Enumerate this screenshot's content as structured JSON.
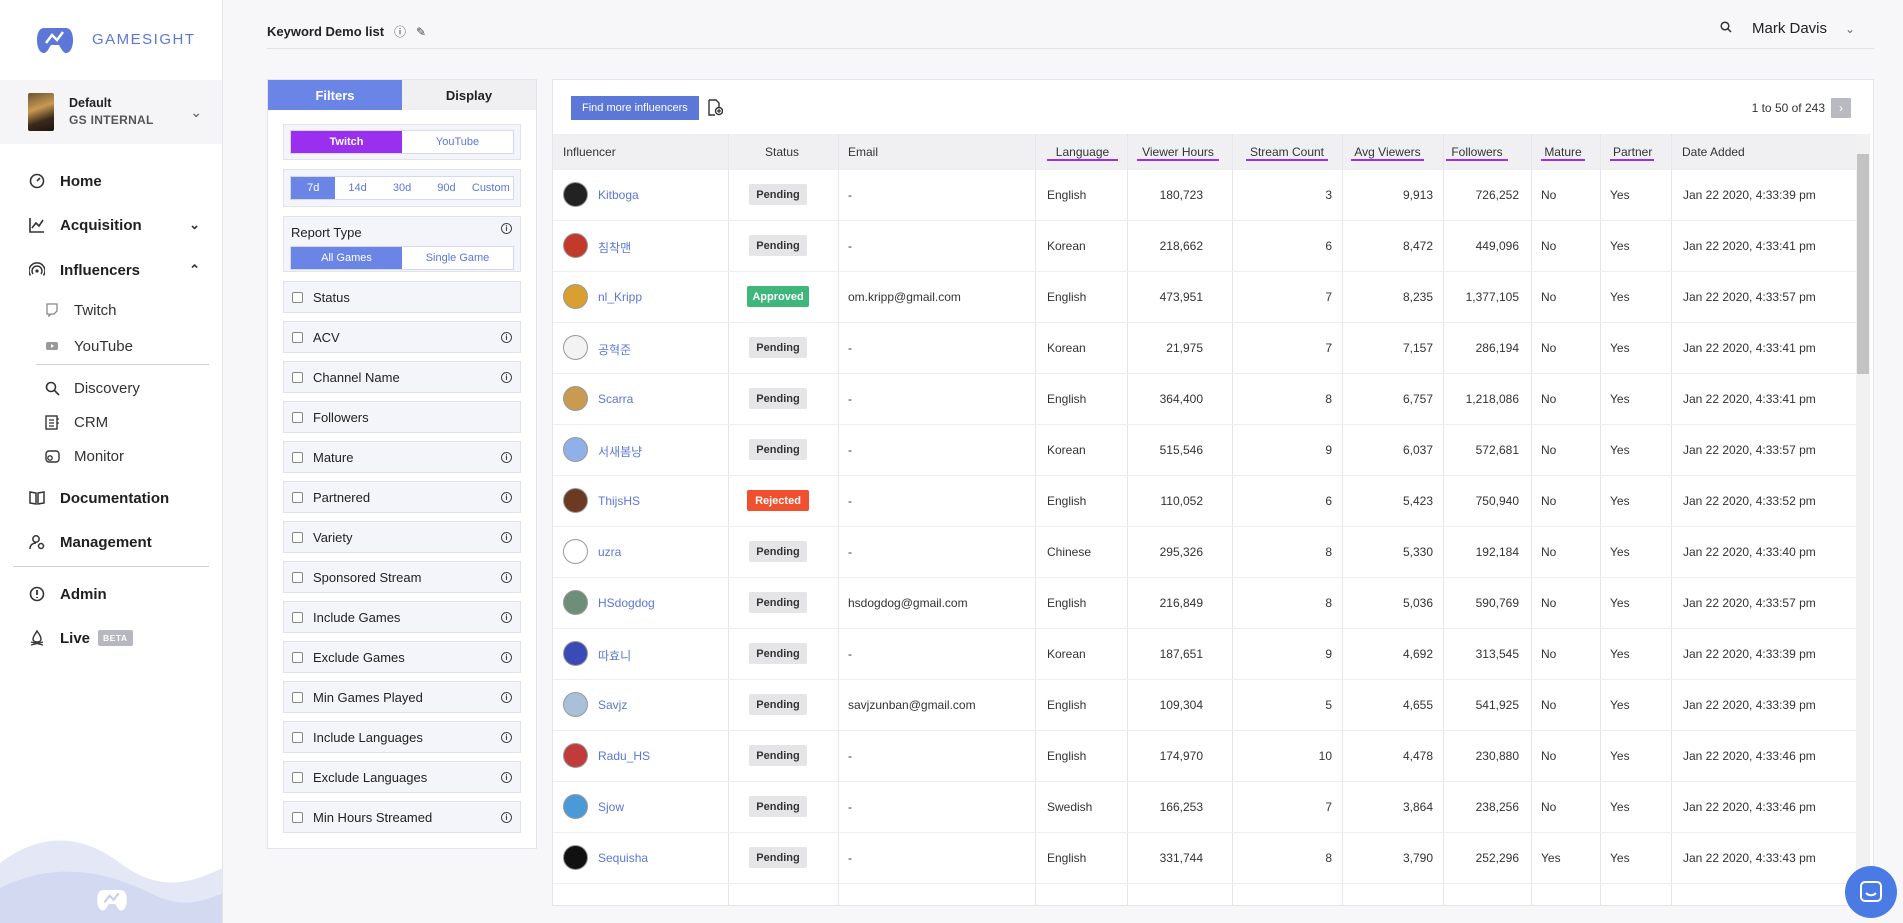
{
  "brand": {
    "name": "GAMESIGHT"
  },
  "org": {
    "name": "Default",
    "team": "GS INTERNAL"
  },
  "nav": {
    "home": "Home",
    "acquisition": "Acquisition",
    "influencers": "Influencers",
    "twitch": "Twitch",
    "youtube": "YouTube",
    "discovery": "Discovery",
    "crm": "CRM",
    "monitor": "Monitor",
    "documentation": "Documentation",
    "management": "Management",
    "admin": "Admin",
    "live": "Live",
    "live_badge": "BETA"
  },
  "header": {
    "title": "Keyword Demo list",
    "user": "Mark Davis"
  },
  "filters": {
    "tab_filters": "Filters",
    "tab_display": "Display",
    "platforms": [
      "Twitch",
      "YouTube"
    ],
    "ranges": [
      "7d",
      "14d",
      "30d",
      "90d",
      "Custom"
    ],
    "report_type_label": "Report Type",
    "report_types": [
      "All Games",
      "Single Game"
    ],
    "items": [
      "Status",
      "ACV",
      "Channel Name",
      "Followers",
      "Mature",
      "Partnered",
      "Variety",
      "Sponsored Stream",
      "Include Games",
      "Exclude Games",
      "Min Games Played",
      "Include Languages",
      "Exclude Languages",
      "Min Hours Streamed"
    ]
  },
  "table": {
    "find_more": "Find more influencers",
    "pagination": "1 to 50 of 243",
    "columns": [
      "Influencer",
      "Status",
      "Email",
      "Language",
      "Viewer Hours",
      "Stream Count",
      "Avg Viewers",
      "Followers",
      "Mature",
      "Partner",
      "Date Added"
    ],
    "rows": [
      {
        "name": "Kitboga",
        "status": "Pending",
        "email": "-",
        "language": "English",
        "viewer_hours": "180,723",
        "stream_count": "3",
        "avg_viewers": "9,913",
        "followers": "726,252",
        "mature": "No",
        "partner": "Yes",
        "date_added": "Jan 22 2020, 4:33:39 pm"
      },
      {
        "name": "침착맨",
        "status": "Pending",
        "email": "-",
        "language": "Korean",
        "viewer_hours": "218,662",
        "stream_count": "6",
        "avg_viewers": "8,472",
        "followers": "449,096",
        "mature": "No",
        "partner": "Yes",
        "date_added": "Jan 22 2020, 4:33:41 pm"
      },
      {
        "name": "nl_Kripp",
        "status": "Approved",
        "email": "om.kripp@gmail.com",
        "language": "English",
        "viewer_hours": "473,951",
        "stream_count": "7",
        "avg_viewers": "8,235",
        "followers": "1,377,105",
        "mature": "No",
        "partner": "Yes",
        "date_added": "Jan 22 2020, 4:33:57 pm"
      },
      {
        "name": "공혁준",
        "status": "Pending",
        "email": "-",
        "language": "Korean",
        "viewer_hours": "21,975",
        "stream_count": "7",
        "avg_viewers": "7,157",
        "followers": "286,194",
        "mature": "No",
        "partner": "Yes",
        "date_added": "Jan 22 2020, 4:33:41 pm"
      },
      {
        "name": "Scarra",
        "status": "Pending",
        "email": "-",
        "language": "English",
        "viewer_hours": "364,400",
        "stream_count": "8",
        "avg_viewers": "6,757",
        "followers": "1,218,086",
        "mature": "No",
        "partner": "Yes",
        "date_added": "Jan 22 2020, 4:33:41 pm"
      },
      {
        "name": "서새봄냥",
        "status": "Pending",
        "email": "-",
        "language": "Korean",
        "viewer_hours": "515,546",
        "stream_count": "9",
        "avg_viewers": "6,037",
        "followers": "572,681",
        "mature": "No",
        "partner": "Yes",
        "date_added": "Jan 22 2020, 4:33:57 pm"
      },
      {
        "name": "ThijsHS",
        "status": "Rejected",
        "email": "-",
        "language": "English",
        "viewer_hours": "110,052",
        "stream_count": "6",
        "avg_viewers": "5,423",
        "followers": "750,940",
        "mature": "No",
        "partner": "Yes",
        "date_added": "Jan 22 2020, 4:33:52 pm"
      },
      {
        "name": "uzra",
        "status": "Pending",
        "email": "-",
        "language": "Chinese",
        "viewer_hours": "295,326",
        "stream_count": "8",
        "avg_viewers": "5,330",
        "followers": "192,184",
        "mature": "No",
        "partner": "Yes",
        "date_added": "Jan 22 2020, 4:33:40 pm"
      },
      {
        "name": "HSdogdog",
        "status": "Pending",
        "email": "hsdogdog@gmail.com",
        "language": "English",
        "viewer_hours": "216,849",
        "stream_count": "8",
        "avg_viewers": "5,036",
        "followers": "590,769",
        "mature": "No",
        "partner": "Yes",
        "date_added": "Jan 22 2020, 4:33:57 pm"
      },
      {
        "name": "따효니",
        "status": "Pending",
        "email": "-",
        "language": "Korean",
        "viewer_hours": "187,651",
        "stream_count": "9",
        "avg_viewers": "4,692",
        "followers": "313,545",
        "mature": "No",
        "partner": "Yes",
        "date_added": "Jan 22 2020, 4:33:39 pm"
      },
      {
        "name": "Savjz",
        "status": "Pending",
        "email": "savjzunban@gmail.com",
        "language": "English",
        "viewer_hours": "109,304",
        "stream_count": "5",
        "avg_viewers": "4,655",
        "followers": "541,925",
        "mature": "No",
        "partner": "Yes",
        "date_added": "Jan 22 2020, 4:33:39 pm"
      },
      {
        "name": "Radu_HS",
        "status": "Pending",
        "email": "-",
        "language": "English",
        "viewer_hours": "174,970",
        "stream_count": "10",
        "avg_viewers": "4,478",
        "followers": "230,880",
        "mature": "No",
        "partner": "Yes",
        "date_added": "Jan 22 2020, 4:33:46 pm"
      },
      {
        "name": "Sjow",
        "status": "Pending",
        "email": "-",
        "language": "Swedish",
        "viewer_hours": "166,253",
        "stream_count": "7",
        "avg_viewers": "3,864",
        "followers": "238,256",
        "mature": "No",
        "partner": "Yes",
        "date_added": "Jan 22 2020, 4:33:46 pm"
      },
      {
        "name": "Sequisha",
        "status": "Pending",
        "email": "-",
        "language": "English",
        "viewer_hours": "331,744",
        "stream_count": "8",
        "avg_viewers": "3,790",
        "followers": "252,296",
        "mature": "Yes",
        "partner": "Yes",
        "date_added": "Jan 22 2020, 4:33:43 pm"
      }
    ]
  },
  "colors": {
    "accent": "#5b77d8",
    "purple": "#9a2ff0",
    "approved": "#3fb67a",
    "rejected": "#f0502e",
    "pending": "#e5e5e8"
  },
  "avatar_colors": [
    "#222",
    "#c23a2b",
    "#d8a030",
    "#f3f3f3",
    "#c89a52",
    "#8fb0e8",
    "#6b3a22",
    "#fff",
    "#6d8f7a",
    "#3a4bb8",
    "#a8c0d8",
    "#c13b3b",
    "#4a9ad8",
    "#111"
  ]
}
